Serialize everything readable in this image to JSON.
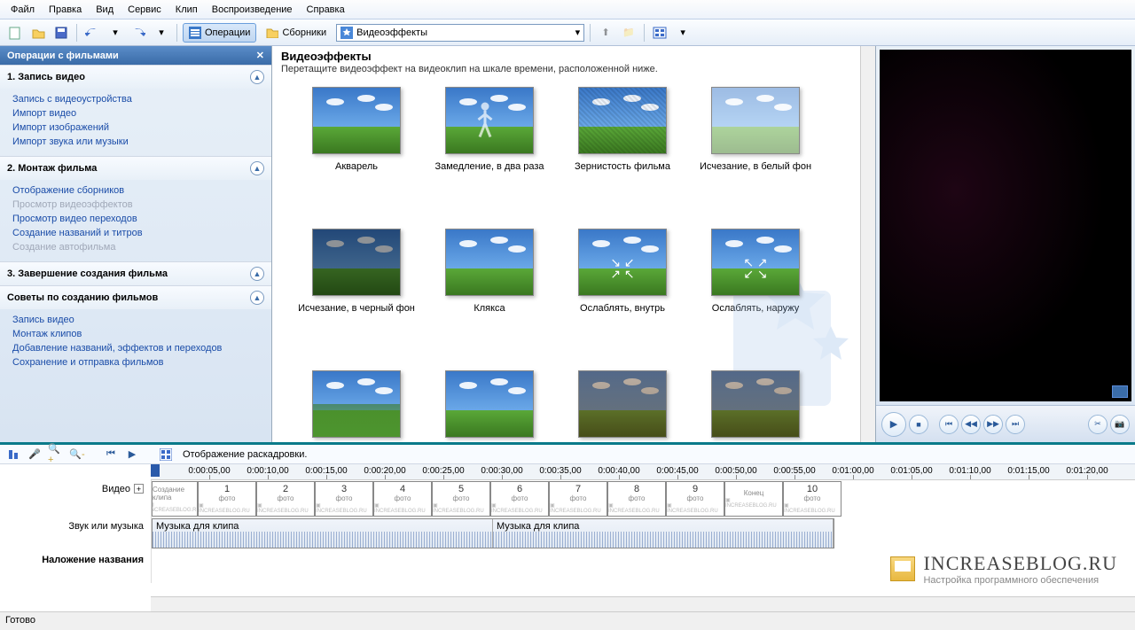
{
  "menu": [
    "Файл",
    "Правка",
    "Вид",
    "Сервис",
    "Клип",
    "Воспроизведение",
    "Справка"
  ],
  "toolbar": {
    "operations": "Операции",
    "collections": "Сборники",
    "dropdown_value": "Видеоэффекты"
  },
  "sidebar": {
    "title": "Операции с фильмами",
    "sections": [
      {
        "head": "1. Запись видео",
        "items": [
          {
            "label": "Запись с видеоустройства",
            "disabled": false
          },
          {
            "label": "Импорт видео",
            "disabled": false
          },
          {
            "label": "Импорт изображений",
            "disabled": false
          },
          {
            "label": "Импорт звука или музыки",
            "disabled": false
          }
        ]
      },
      {
        "head": "2. Монтаж фильма",
        "items": [
          {
            "label": "Отображение сборников",
            "disabled": false
          },
          {
            "label": "Просмотр видеоэффектов",
            "disabled": true
          },
          {
            "label": "Просмотр видео переходов",
            "disabled": false
          },
          {
            "label": "Создание названий и титров",
            "disabled": false
          },
          {
            "label": "Создание автофильма",
            "disabled": true
          }
        ]
      },
      {
        "head": "3. Завершение создания фильма",
        "items": []
      },
      {
        "head": "Советы по созданию фильмов",
        "items": [
          {
            "label": "Запись видео",
            "disabled": false
          },
          {
            "label": "Монтаж клипов",
            "disabled": false
          },
          {
            "label": "Добавление названий, эффектов и переходов",
            "disabled": false
          },
          {
            "label": "Сохранение и отправка фильмов",
            "disabled": false
          }
        ]
      }
    ]
  },
  "content": {
    "title": "Видеоэффекты",
    "subtitle": "Перетащите видеоэффект на видеоклип на шкале времени, расположенной ниже.",
    "effects": [
      "Акварель",
      "Замедление, в два раза",
      "Зернистость фильма",
      "Исчезание, в белый фон",
      "Исчезание, в черный фон",
      "Клякса",
      "Ослаблять, внутрь",
      "Ослаблять, наружу",
      "",
      "",
      "",
      ""
    ]
  },
  "timeline": {
    "storyboard_label": "Отображение раскадровки.",
    "ruler": [
      "0:00:05,00",
      "0:00:10,00",
      "0:00:15,00",
      "0:00:20,00",
      "0:00:25,00",
      "0:00:30,00",
      "0:00:35,00",
      "0:00:40,00",
      "0:00:45,00",
      "0:00:50,00",
      "0:00:55,00",
      "0:01:00,00",
      "0:01:05,00",
      "0:01:10,00",
      "0:01:15,00",
      "0:01:20,00"
    ],
    "tracks": {
      "video": "Видео",
      "audio": "Звук или музыка",
      "title": "Наложение названия"
    },
    "clips": [
      {
        "num": "",
        "lab": "Создание клипа"
      },
      {
        "num": "1",
        "lab": "фото"
      },
      {
        "num": "2",
        "lab": "фото"
      },
      {
        "num": "3",
        "lab": "фото"
      },
      {
        "num": "4",
        "lab": "фото"
      },
      {
        "num": "5",
        "lab": "фото"
      },
      {
        "num": "6",
        "lab": "фото"
      },
      {
        "num": "7",
        "lab": "фото"
      },
      {
        "num": "8",
        "lab": "фото"
      },
      {
        "num": "9",
        "lab": "фото"
      },
      {
        "num": "",
        "lab": "Конец"
      },
      {
        "num": "10",
        "lab": "фото"
      }
    ],
    "audio_label": "Музыка для клипа"
  },
  "watermark": {
    "line1": "INCREASEBLOG.RU",
    "line2": "Настройка программного обеспечения"
  },
  "status": "Готово"
}
